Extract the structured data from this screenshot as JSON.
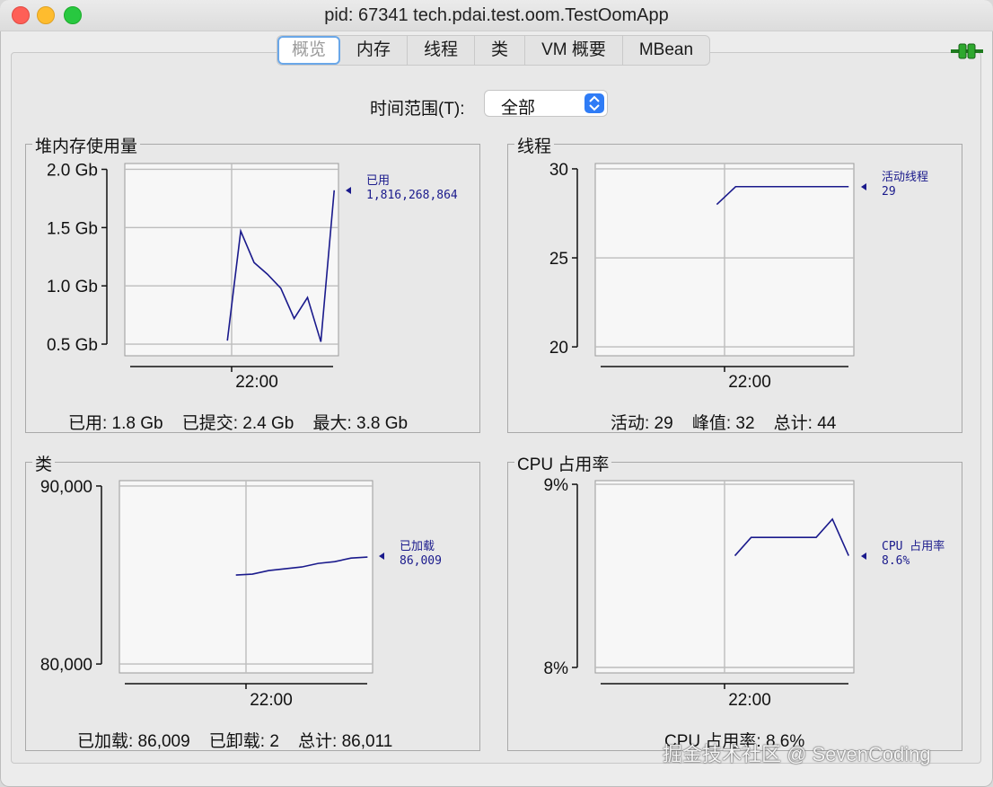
{
  "window": {
    "title": "pid: 67341 tech.pdai.test.oom.TestOomApp"
  },
  "tabs": [
    {
      "label": "概览",
      "active": true
    },
    {
      "label": "内存",
      "active": false
    },
    {
      "label": "线程",
      "active": false
    },
    {
      "label": "类",
      "active": false
    },
    {
      "label": "VM 概要",
      "active": false
    },
    {
      "label": "MBean",
      "active": false
    }
  ],
  "time_range": {
    "label": "时间范围(T):",
    "value": "全部"
  },
  "panels": {
    "heap": {
      "title": "堆内存使用量",
      "summary": [
        "已用: 1.8 Gb",
        "已提交: 2.4 Gb",
        "最大: 3.8 Gb"
      ]
    },
    "threads": {
      "title": "线程",
      "summary": [
        "活动: 29",
        "峰值: 32",
        "总计: 44"
      ]
    },
    "classes": {
      "title": "类",
      "summary": [
        "已加载: 86,009",
        "已卸载: 2",
        "总计: 86,011"
      ]
    },
    "cpu": {
      "title": "CPU 占用率",
      "summary": [
        "CPU 占用率: 8.6%"
      ]
    }
  },
  "chart_data": [
    {
      "type": "line",
      "panel": "heap",
      "y_ticks": [
        "0.5 Gb",
        "1.0 Gb",
        "1.5 Gb",
        "2.0 Gb"
      ],
      "ylim": [
        0.4,
        2.05
      ],
      "x_tick": "22:00",
      "series": [
        {
          "name": "已用",
          "value_label": "1,816,268,864",
          "values": [
            0.53,
            1.47,
            1.2,
            1.1,
            0.98,
            0.72,
            0.9,
            0.52,
            1.82
          ]
        }
      ]
    },
    {
      "type": "line",
      "panel": "threads",
      "y_ticks": [
        "20",
        "25",
        "30"
      ],
      "ylim": [
        19.5,
        30.3
      ],
      "x_tick": "22:00",
      "series": [
        {
          "name": "活动线程",
          "value_label": "29",
          "values": [
            28,
            29,
            29,
            29,
            29,
            29,
            29,
            29
          ]
        }
      ]
    },
    {
      "type": "line",
      "panel": "classes",
      "y_ticks": [
        "80,000",
        "90,000"
      ],
      "ylim": [
        79500,
        90300
      ],
      "x_tick": "22:00",
      "series": [
        {
          "name": "已加载",
          "value_label": "86,009",
          "values": [
            85000,
            85050,
            85250,
            85350,
            85450,
            85650,
            85750,
            85950,
            86009
          ]
        }
      ]
    },
    {
      "type": "line",
      "panel": "cpu",
      "y_ticks": [
        "8%",
        "9%"
      ],
      "ylim": [
        7.97,
        9.02
      ],
      "x_tick": "22:00",
      "series": [
        {
          "name": "CPU 占用率",
          "value_label": "8.6%",
          "values": [
            8.61,
            8.71,
            8.71,
            8.71,
            8.71,
            8.71,
            8.81,
            8.61
          ]
        }
      ]
    }
  ],
  "watermark": "掘金技术社区 @ SevenCoding"
}
